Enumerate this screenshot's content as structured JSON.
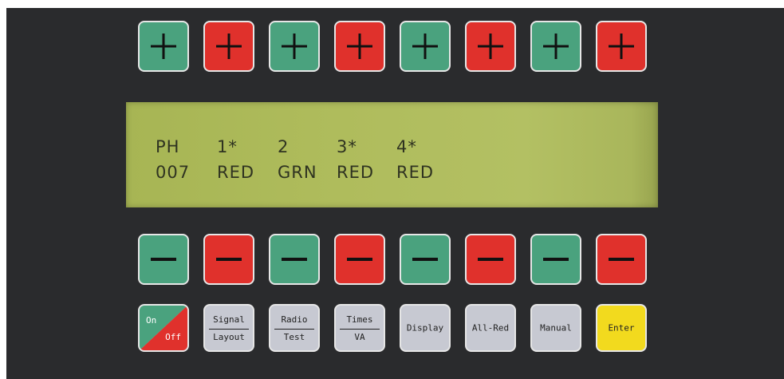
{
  "colors": {
    "panel": "#2a2b2d",
    "green": "#4aa27e",
    "red": "#e0312c",
    "lcd": "#afbc5c",
    "function_key": "#c7c9d2",
    "enter_key": "#f2da1e"
  },
  "increment_keys": [
    {
      "color": "green",
      "icon": "plus-icon"
    },
    {
      "color": "red",
      "icon": "plus-icon"
    },
    {
      "color": "green",
      "icon": "plus-icon"
    },
    {
      "color": "red",
      "icon": "plus-icon"
    },
    {
      "color": "green",
      "icon": "plus-icon"
    },
    {
      "color": "red",
      "icon": "plus-icon"
    },
    {
      "color": "green",
      "icon": "plus-icon"
    },
    {
      "color": "red",
      "icon": "plus-icon"
    }
  ],
  "decrement_keys": [
    {
      "color": "green",
      "icon": "minus-icon"
    },
    {
      "color": "red",
      "icon": "minus-icon"
    },
    {
      "color": "green",
      "icon": "minus-icon"
    },
    {
      "color": "red",
      "icon": "minus-icon"
    },
    {
      "color": "green",
      "icon": "minus-icon"
    },
    {
      "color": "red",
      "icon": "minus-icon"
    },
    {
      "color": "green",
      "icon": "minus-icon"
    },
    {
      "color": "red",
      "icon": "minus-icon"
    }
  ],
  "lcd": {
    "row1": [
      "PH",
      "1*",
      "2",
      "3*",
      "4*"
    ],
    "row2": [
      "007",
      "RED",
      "GRN",
      "RED",
      "RED"
    ]
  },
  "function_keys": {
    "on_off": {
      "top": "On",
      "bottom": "Off"
    },
    "signal_layout": {
      "top": "Signal",
      "bottom": "Layout"
    },
    "radio_test": {
      "top": "Radio",
      "bottom": "Test"
    },
    "times_va": {
      "top": "Times",
      "bottom": "VA"
    },
    "display": "Display",
    "all_red": "All-Red",
    "manual": "Manual",
    "enter": "Enter"
  }
}
